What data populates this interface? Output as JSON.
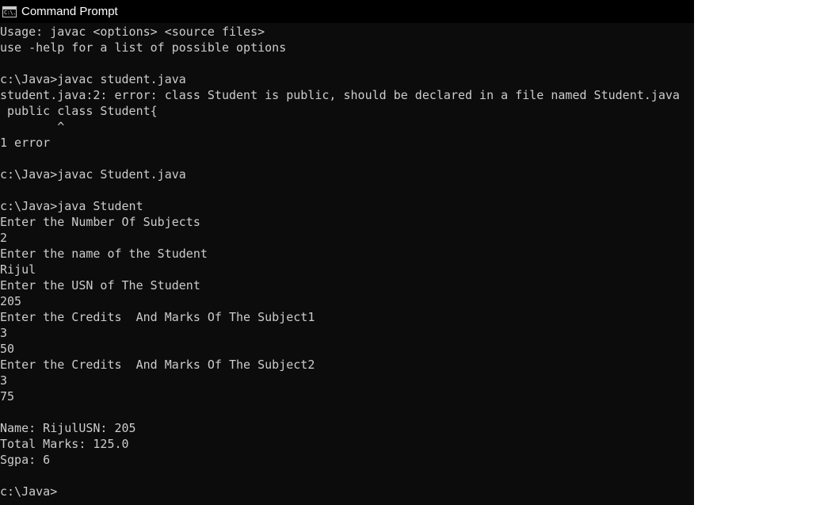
{
  "window": {
    "title": "Command Prompt",
    "icon": "command-prompt-icon",
    "icon_text": "C:\\."
  },
  "console": {
    "lines": [
      "Usage: javac <options> <source files>",
      "use -help for a list of possible options",
      "",
      "c:\\Java>javac student.java",
      "student.java:2: error: class Student is public, should be declared in a file named Student.java",
      " public class Student{",
      "        ^",
      "1 error",
      "",
      "c:\\Java>javac Student.java",
      "",
      "c:\\Java>java Student",
      "Enter the Number Of Subjects",
      "2",
      "Enter the name of the Student",
      "Rijul",
      "Enter the USN of The Student",
      "205",
      "Enter the Credits  And Marks Of The Subject1",
      "3",
      "50",
      "Enter the Credits  And Marks Of The Subject2",
      "3",
      "75",
      "",
      "Name: RijulUSN: 205",
      "Total Marks: 125.0",
      "Sgpa: 6",
      "",
      "c:\\Java>"
    ]
  },
  "colors": {
    "console_background": "#0c0c0c",
    "console_text": "#cccccc",
    "titlebar_background": "#000000",
    "titlebar_text": "#ffffff"
  }
}
